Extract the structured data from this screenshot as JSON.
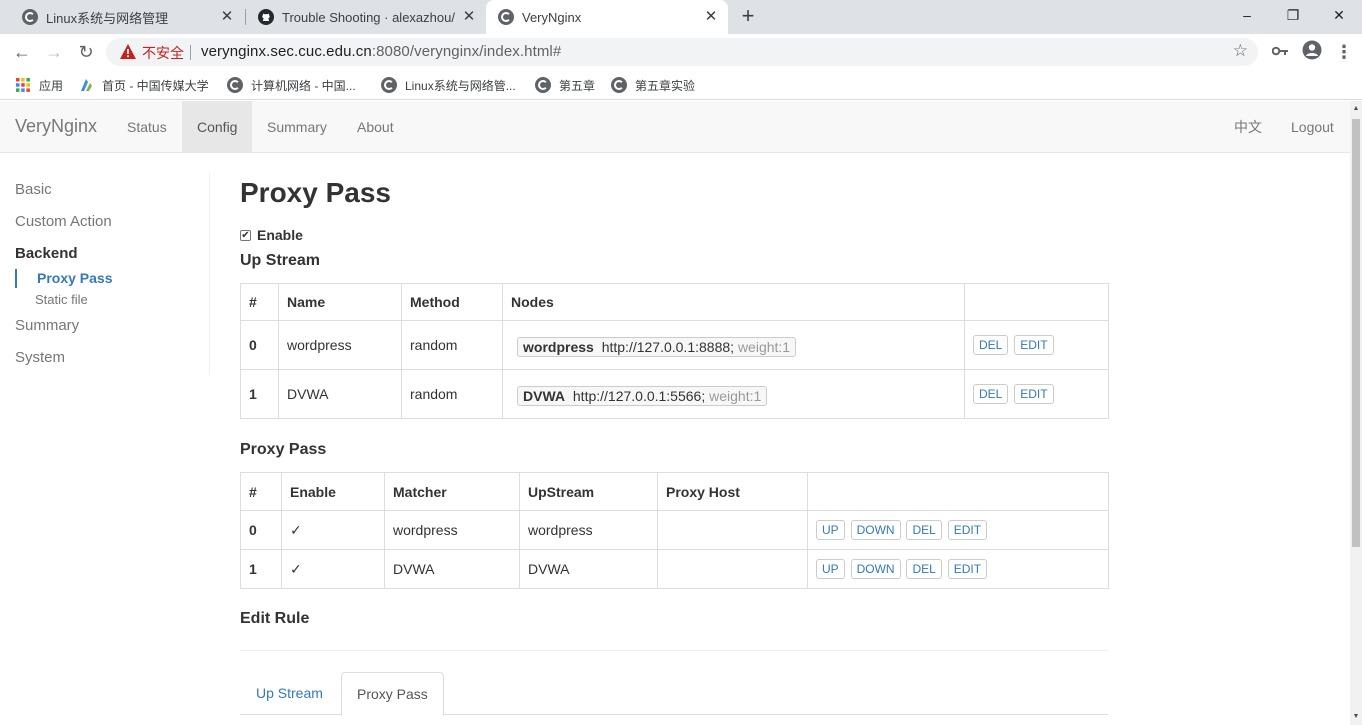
{
  "browser": {
    "tabs": [
      {
        "title": "Linux系统与网络管理",
        "active": false
      },
      {
        "title": "Trouble Shooting · alexazhou/",
        "active": false
      },
      {
        "title": "VeryNginx",
        "active": true
      }
    ],
    "new_tab": "+",
    "window_controls": [
      "–",
      "❐",
      "✕"
    ],
    "security_label": "不安全",
    "url_host": "verynginx.sec.cuc.edu.cn",
    "url_rest": ":8080/verynginx/index.html#",
    "bookmarks": [
      {
        "label": "应用",
        "icon": "apps-grid-icon"
      },
      {
        "label": "首页 - 中国传媒大学",
        "icon": "cuc-logo-icon"
      },
      {
        "label": "计算机网络 - 中国...",
        "icon": "globe-icon"
      },
      {
        "label": "Linux系统与网络管...",
        "icon": "globe-icon"
      },
      {
        "label": "第五章",
        "icon": "globe-icon"
      },
      {
        "label": "第五章实验",
        "icon": "globe-icon"
      }
    ]
  },
  "nav": {
    "brand": "VeryNginx",
    "links": [
      "Status",
      "Config",
      "Summary",
      "About"
    ],
    "active": "Config",
    "right": [
      "中文",
      "Logout"
    ]
  },
  "sidebar": {
    "items": [
      "Basic",
      "Custom Action",
      "Backend",
      "Summary",
      "System"
    ],
    "sub_items": [
      "Proxy Pass",
      "Static file"
    ]
  },
  "main": {
    "title": "Proxy Pass",
    "enable_label": "Enable",
    "enabled": true,
    "upstream": {
      "heading": "Up Stream",
      "columns": [
        "#",
        "Name",
        "Method",
        "Nodes",
        ""
      ],
      "rows": [
        {
          "idx": "0",
          "name": "wordpress",
          "method": "random",
          "node_name": "wordpress",
          "node_addr": "http://127.0.0.1:8888;",
          "node_weight": "weight:1"
        },
        {
          "idx": "1",
          "name": "DVWA",
          "method": "random",
          "node_name": "DVWA",
          "node_addr": "http://127.0.0.1:5566;",
          "node_weight": "weight:1"
        }
      ],
      "actions": [
        "DEL",
        "EDIT"
      ]
    },
    "proxy_pass": {
      "heading": "Proxy Pass",
      "columns": [
        "#",
        "Enable",
        "Matcher",
        "UpStream",
        "Proxy Host",
        ""
      ],
      "rows": [
        {
          "idx": "0",
          "enable": "✓",
          "matcher": "wordpress",
          "upstream": "wordpress",
          "proxy_host": ""
        },
        {
          "idx": "1",
          "enable": "✓",
          "matcher": "DVWA",
          "upstream": "DVWA",
          "proxy_host": ""
        }
      ],
      "actions": [
        "UP",
        "DOWN",
        "DEL",
        "EDIT"
      ]
    },
    "edit_rule": {
      "heading": "Edit Rule",
      "tabs": [
        "Up Stream",
        "Proxy Pass"
      ],
      "active_tab": "Proxy Pass"
    }
  }
}
